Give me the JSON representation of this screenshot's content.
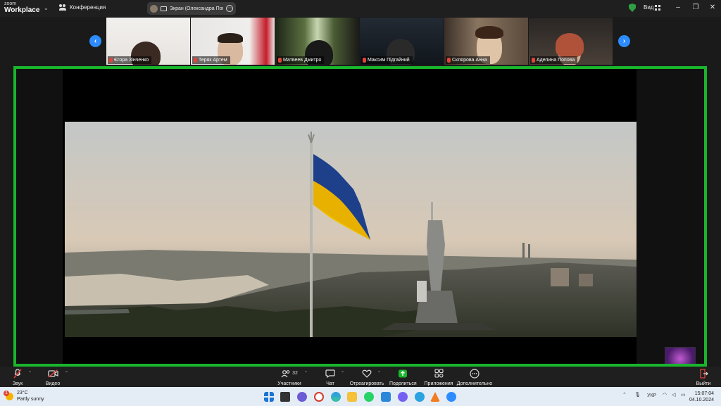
{
  "titlebar": {
    "brand_small": "zoom",
    "brand_big": "Workplace",
    "conference_label": "Конференция",
    "share_pill_text": "Экран (Олександра Погреб",
    "view_label": "Вид",
    "minimize": "–",
    "restore": "❐",
    "close": "✕"
  },
  "participants": [
    {
      "name": "Єгора Зінченко"
    },
    {
      "name": "Теряк Артем"
    },
    {
      "name": "Матвеев Дмитро"
    },
    {
      "name": "Максим Підгайний"
    },
    {
      "name": "Склярова Анна"
    },
    {
      "name": "Аделина Попова"
    }
  ],
  "nav": {
    "prev": "‹",
    "next": "›"
  },
  "toolbar": {
    "audio": "Звук",
    "video": "Видео",
    "participants": "Участники",
    "participants_count": "32",
    "chat": "Чат",
    "react": "Отреагировать",
    "share": "Поделиться",
    "apps": "Приложения",
    "more": "Дополнительно",
    "leave": "Выйти"
  },
  "taskbar": {
    "weather_temp": "23°C",
    "weather_desc": "Partly sunny",
    "weather_badge": "1",
    "lang": "УКР",
    "time": "15:07:04",
    "date": "04.10.2024"
  },
  "colors": {
    "share_border": "#19b52c",
    "accent": "#2d8cff",
    "share_button": "#19b52c",
    "leave": "#e0453a"
  }
}
